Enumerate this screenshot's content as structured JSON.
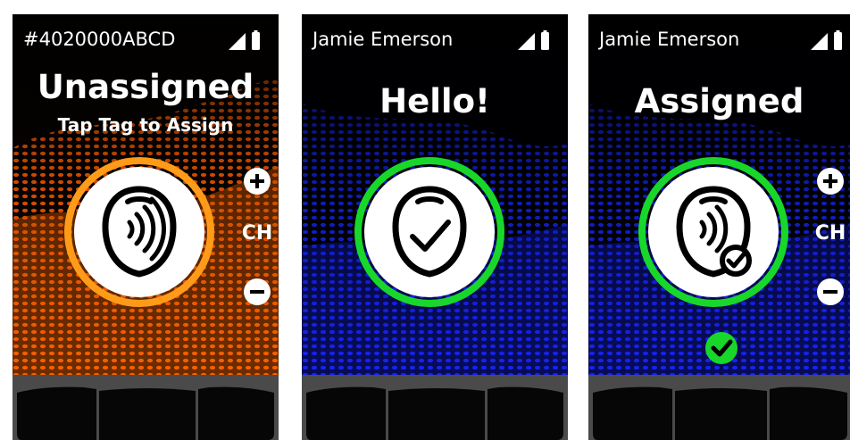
{
  "screens": [
    {
      "status_title": "#4020000ABCD",
      "headline": "Unassigned",
      "subline": "Tap Tag to Assign",
      "ring_color": "#ff9b18",
      "background_color": "#ff6a00",
      "tag_state": "nfc",
      "channel_label": "CH",
      "show_channel_controls": true
    },
    {
      "status_title": "Jamie Emerson",
      "headline": "Hello!",
      "subline": "",
      "ring_color": "#18d72a",
      "background_color": "#1826ff",
      "tag_state": "check",
      "channel_label": "",
      "show_channel_controls": false
    },
    {
      "status_title": "Jamie Emerson",
      "headline": "Assigned",
      "subline": "",
      "ring_color": "#18d72a",
      "background_color": "#1826ff",
      "tag_state": "nfc-check",
      "channel_label": "CH",
      "show_channel_controls": true,
      "success_badge": "check-circle-icon"
    }
  ]
}
